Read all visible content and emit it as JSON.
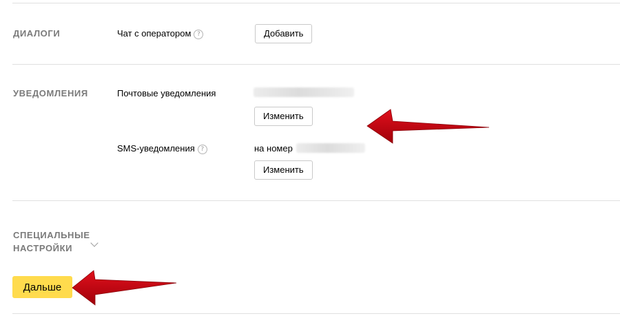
{
  "dialogs": {
    "title": "ДИАЛОГИ",
    "operator_chat_label": "Чат с оператором",
    "add_button": "Добавить"
  },
  "notifications": {
    "title": "УВЕДОМЛЕНИЯ",
    "email_label": "Почтовые уведомления",
    "email_change_button": "Изменить",
    "sms_label": "SMS-уведомления",
    "sms_number_prefix": "на номер",
    "sms_change_button": "Изменить"
  },
  "special": {
    "title_line1": "СПЕЦИАЛЬНЫЕ",
    "title_line2": "НАСТРОЙКИ"
  },
  "next_button": "Дальше",
  "help_glyph": "?",
  "colors": {
    "primary_button": "#ffdb4d",
    "arrow": "#c8000f",
    "section_title": "#7a7a7a",
    "divider": "#e0e0e0"
  },
  "icons": [
    "help-icon",
    "chevron-down-icon",
    "annotation-arrow"
  ]
}
